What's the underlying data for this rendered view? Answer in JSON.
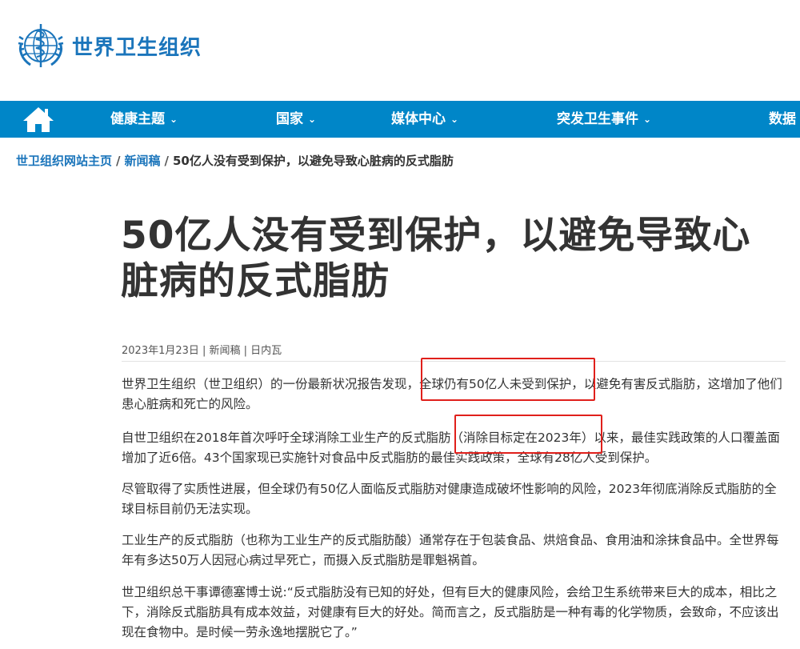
{
  "header": {
    "logo_text": "世界卫生组织",
    "logo_icon": "who-emblem-icon"
  },
  "nav": {
    "home_icon": "home-icon",
    "items": [
      {
        "label": "健康主题"
      },
      {
        "label": "国家"
      },
      {
        "label": "媒体中心"
      },
      {
        "label": "突发卫生事件"
      },
      {
        "label": "数据"
      }
    ]
  },
  "breadcrumb": {
    "home": "世卫组织网站主页",
    "sep1": "/",
    "section": "新闻稿",
    "sep2": "/",
    "current": "50亿人没有受到保护，以避免导致心脏病的反式脂肪"
  },
  "article": {
    "title": "50亿人没有受到保护，以避免导致心脏病的反式脂肪",
    "meta": "2023年1月23日 | 新闻稿 | 日内瓦",
    "paragraphs": [
      "世界卫生组织（世卫组织）的一份最新状况报告发现，全球仍有50亿人未受到保护，以避免有害反式脂肪，这增加了他们患心脏病和死亡的风险。",
      "自世卫组织在2018年首次呼吁全球消除工业生产的反式脂肪（消除目标定在2023年）以来，最佳实践政策的人口覆盖面增加了近6倍。43个国家现已实施针对食品中反式脂肪的最佳实践政策，全球有28亿人受到保护。",
      "尽管取得了实质性进展，但全球仍有50亿人面临反式脂肪对健康造成破坏性影响的风险，2023年彻底消除反式脂肪的全球目标目前仍无法实现。",
      "工业生产的反式脂肪（也称为工业生产的反式脂肪酸）通常存在于包装食品、烘焙食品、食用油和涂抹食品中。全世界每年有多达50万人因冠心病过早死亡，而摄入反式脂肪是罪魁祸首。",
      "世卫组织总干事谭德塞博士说:“反式脂肪没有已知的好处，但有巨大的健康风险，会给卫生系统带来巨大的成本，相比之下，消除反式脂肪具有成本效益，对健康有巨大的好处。简而言之，反式脂肪是一种有毒的化学物质，会致命，不应该出现在食物中。是时候一劳永逸地摆脱它了。”"
    ]
  },
  "colors": {
    "brand": "#1b75bb",
    "nav_bg": "#0086c8",
    "highlight": "#e0201b"
  }
}
